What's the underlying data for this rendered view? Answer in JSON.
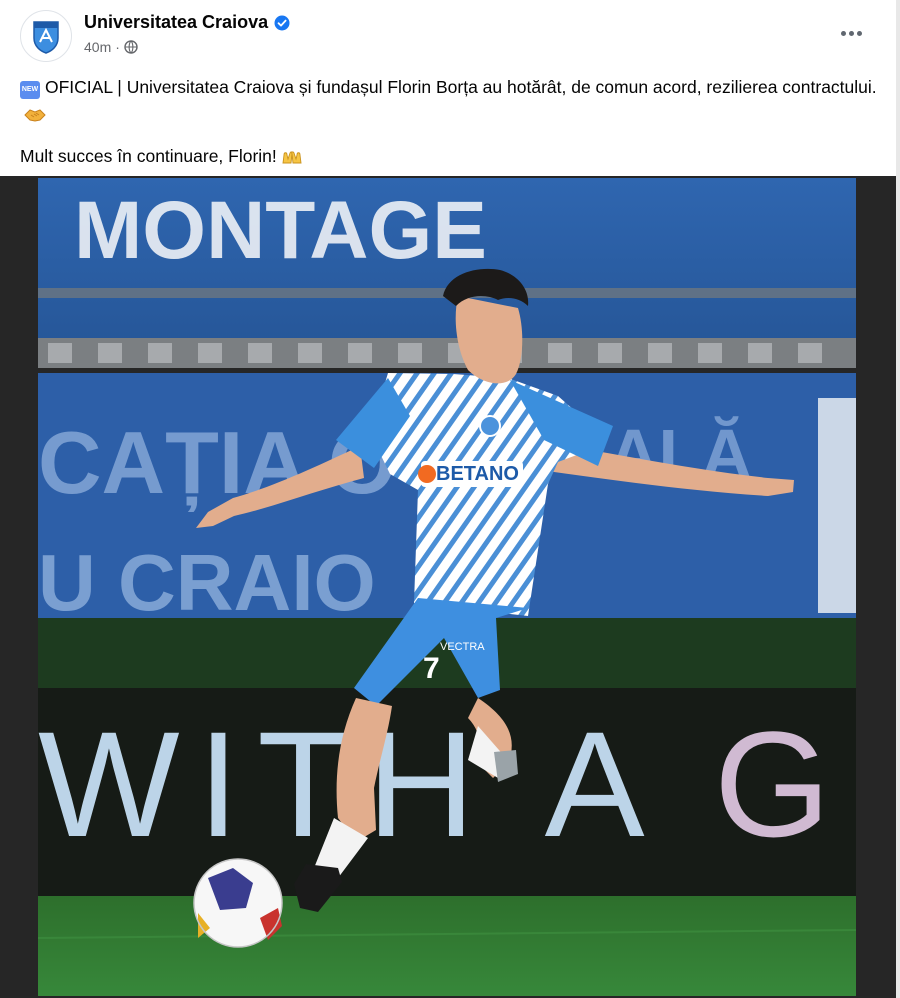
{
  "post": {
    "page_name": "Universitatea Craiova",
    "timestamp": "40m",
    "separator": "·",
    "audience_icon": "globe-icon",
    "verified_icon": "verified-badge-icon",
    "more_icon": "more-options-icon",
    "badge_text": "NEW",
    "line1": "OFICIAL | Universitatea Craiova și fundașul Florin Borța au hotărât, de comun acord, rezilierea contractului.",
    "line1_emoji": "handshake-emoji",
    "line2": "Mult succes în continuare, Florin!",
    "line2_emoji": "raised-hands-emoji"
  },
  "photo": {
    "banner_top": "MONTAGE",
    "banner_mid_1": "CAȚIA O",
    "banner_mid_2": "ALĂ",
    "banner_mid_3": "U CRAIO",
    "led_text_1": "WITH A",
    "led_text_2": "G",
    "sponsor": "BETANO",
    "shirt_number": "7",
    "shorts_sponsor": "VECTRA"
  },
  "colors": {
    "brand_blue": "#1877f2",
    "stand_blue": "#2d5fa8",
    "kit_blue": "#3e8fe0",
    "pitch_green": "#2f7a2e",
    "frame_dark": "#262626",
    "meta_gray": "#65676b"
  }
}
